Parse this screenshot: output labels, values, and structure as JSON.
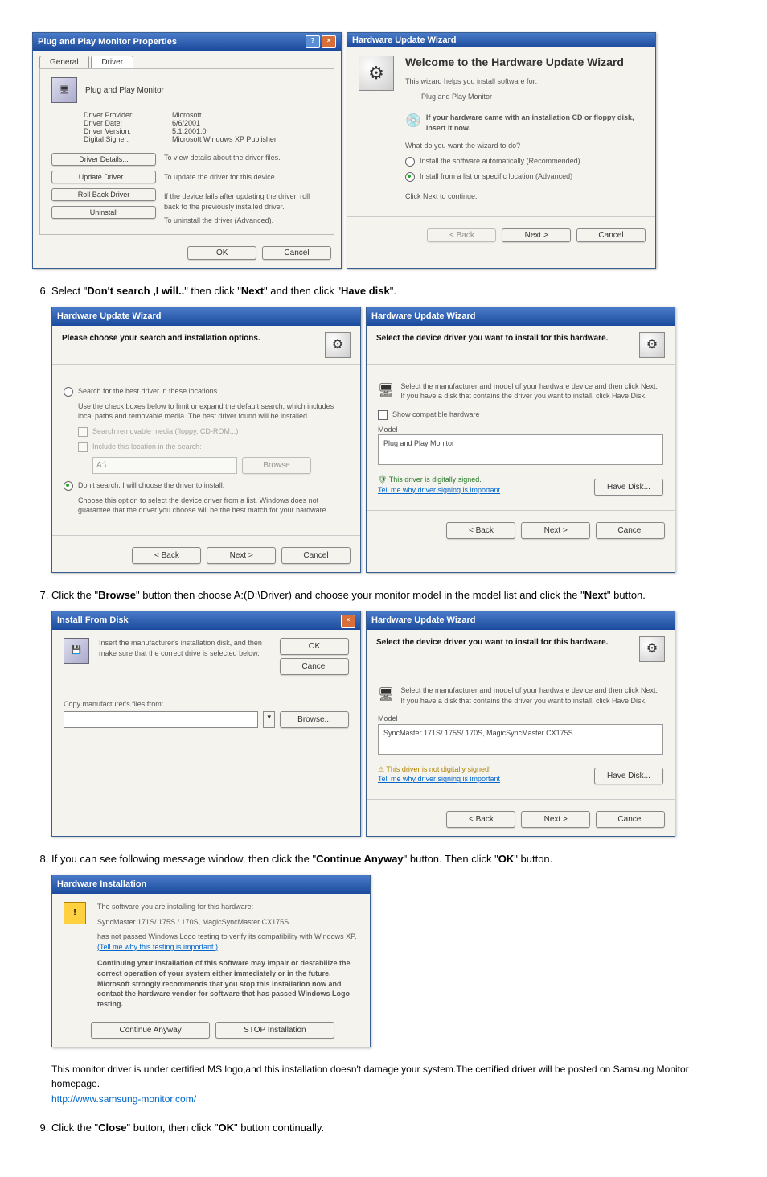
{
  "step5": {
    "properties": {
      "title": "Plug and Play Monitor Properties",
      "tab_general": "General",
      "tab_driver": "Driver",
      "heading": "Plug and Play Monitor",
      "rows": {
        "provider_label": "Driver Provider:",
        "provider_value": "Microsoft",
        "date_label": "Driver Date:",
        "date_value": "6/6/2001",
        "version_label": "Driver Version:",
        "version_value": "5.1.2001.0",
        "signer_label": "Digital Signer:",
        "signer_value": "Microsoft Windows XP Publisher"
      },
      "btn_details": "Driver Details...",
      "btn_details_desc": "To view details about the driver files.",
      "btn_update": "Update Driver...",
      "btn_update_desc": "To update the driver for this device.",
      "btn_rollback": "Roll Back Driver",
      "btn_rollback_desc": "If the device fails after updating the driver, roll back to the previously installed driver.",
      "btn_uninstall": "Uninstall",
      "btn_uninstall_desc": "To uninstall the driver (Advanced).",
      "ok": "OK",
      "cancel": "Cancel"
    },
    "wizard_welcome": {
      "title": "Hardware Update Wizard",
      "heading": "Welcome to the Hardware Update Wizard",
      "line1": "This wizard helps you install software for:",
      "line2": "Plug and Play Monitor",
      "cd_hint": "If your hardware came with an installation CD or floppy disk, insert it now.",
      "question": "What do you want the wizard to do?",
      "opt1": "Install the software automatically (Recommended)",
      "opt2": "Install from a list or specific location (Advanced)",
      "continue": "Click Next to continue.",
      "back": "< Back",
      "next": "Next >",
      "cancel": "Cancel"
    }
  },
  "step6": {
    "text": "Select \"Don't search ,I will..\" then click \"Next\" and then click \"Have disk\".",
    "left": {
      "title": "Hardware Update Wizard",
      "heading": "Please choose your search and installation options.",
      "opt1": "Search for the best driver in these locations.",
      "opt1_desc": "Use the check boxes below to limit or expand the default search, which includes local paths and removable media. The best driver found will be installed.",
      "chk1": "Search removable media (floppy, CD-ROM...)",
      "chk2": "Include this location in the search:",
      "path": "A:\\",
      "browse": "Browse",
      "opt2": "Don't search. I will choose the driver to install.",
      "opt2_desc": "Choose this option to select the device driver from a list. Windows does not guarantee that the driver you choose will be the best match for your hardware.",
      "back": "< Back",
      "next": "Next >",
      "cancel": "Cancel"
    },
    "right": {
      "title": "Hardware Update Wizard",
      "heading": "Select the device driver you want to install for this hardware.",
      "desc": "Select the manufacturer and model of your hardware device and then click Next. If you have a disk that contains the driver you want to install, click Have Disk.",
      "compat": "Show compatible hardware",
      "model_label": "Model",
      "model_value": "Plug and Play Monitor",
      "signed": "This driver is digitally signed.",
      "tell": "Tell me why driver signing is important",
      "have_disk": "Have Disk...",
      "back": "< Back",
      "next": "Next >",
      "cancel": "Cancel"
    }
  },
  "step7": {
    "text": "Click the \"Browse\" button then choose A:(D:\\Driver) and choose your monitor model in the model list and click the \"Next\" button.",
    "left": {
      "title": "Install From Disk",
      "desc": "Insert the manufacturer's installation disk, and then make sure that the correct drive is selected below.",
      "ok": "OK",
      "cancel": "Cancel",
      "copy_label": "Copy manufacturer's files from:",
      "path": "",
      "browse": "Browse..."
    },
    "right": {
      "title": "Hardware Update Wizard",
      "heading": "Select the device driver you want to install for this hardware.",
      "desc": "Select the manufacturer and model of your hardware device and then click Next. If you have a disk that contains the driver you want to install, click Have Disk.",
      "model_label": "Model",
      "model_value": "SyncMaster 171S/ 175S/ 170S, MagicSyncMaster CX175S",
      "signed": "This driver is not digitally signed!",
      "tell": "Tell me why driver signing is important",
      "have_disk": "Have Disk...",
      "back": "< Back",
      "next": "Next >",
      "cancel": "Cancel"
    }
  },
  "step8": {
    "text": "If you can see following message window, then click the \"Continue Anyway\" button. Then click \"OK\" button.",
    "dialog": {
      "title": "Hardware Installation",
      "line1": "The software you are installing for this hardware:",
      "line2": "SyncMaster 171S/ 175S / 170S, MagicSyncMaster CX175S",
      "line3": "has not passed Windows Logo testing to verify its compatibility with Windows XP.",
      "link": "(Tell me why this testing is important.)",
      "line4": "Continuing your installation of this software may impair or destabilize the correct operation of your system either immediately or in the future. Microsoft strongly recommends that you stop this installation now and contact the hardware vendor for software that has passed Windows Logo testing.",
      "continue": "Continue Anyway",
      "stop": "STOP Installation"
    },
    "after1": "This monitor driver is under certified MS logo,and this installation doesn't damage your system.The certified driver will be posted on Samsung Monitor homepage.",
    "after_link": "http://www.samsung-monitor.com/"
  },
  "step9": {
    "text": "Click the \"Close\" button, then click \"OK\" button continually."
  }
}
